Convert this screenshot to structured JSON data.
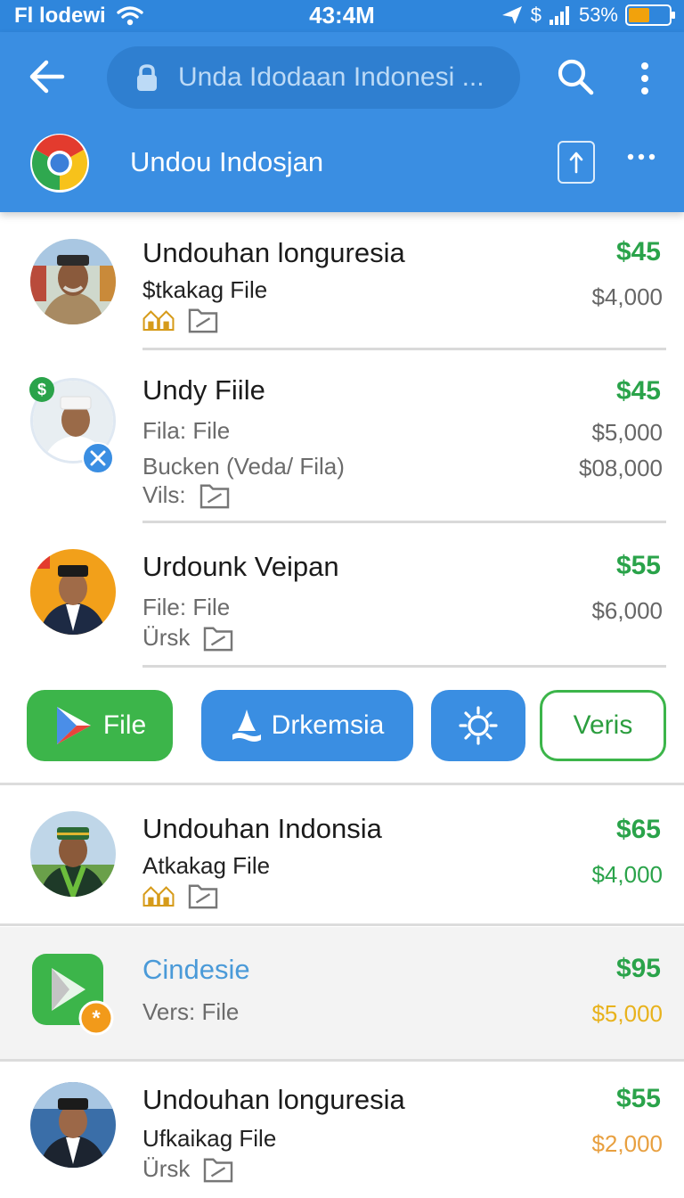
{
  "status_bar": {
    "carrier": "Fl lodewi",
    "time": "43:4M",
    "dollar": "$",
    "battery": "53%",
    "battery_level": 0.53
  },
  "app_bar": {
    "url_text": "Unda Idodaan Indonesi ...",
    "site_title": "Undou Indosjan"
  },
  "items": [
    {
      "title": "Undouhan longuresia",
      "line1": "$tkakag File",
      "price": "$45",
      "price_sub": "$4,000",
      "price_sub_color": "#666666"
    },
    {
      "title": "Undy Fiile",
      "line1": "Fila: File",
      "line2": "Bucken (Veda/ Fila)",
      "line3": "Vils:",
      "price": "$45",
      "price_sub": "$5,000",
      "price_sub2": "$08,000"
    },
    {
      "title": "Urdounk Veipan",
      "line1": "File: File",
      "line2": "Ürsk",
      "price": "$55",
      "price_sub": "$6,000"
    },
    {
      "title": "Undouhan Indonsia",
      "line1": "Atkakag File",
      "price": "$65",
      "price_sub": "$4,000",
      "price_sub_color": "#2aa34a"
    },
    {
      "title": "Cindesie",
      "line1": "Vers: File",
      "price": "$95",
      "price_sub": "$5,000",
      "price_sub_color": "#e8b21c"
    },
    {
      "title": "Undouhan longuresia",
      "line1": "Ufkaikag File",
      "line2": "Ürsk",
      "price": "$55",
      "price_sub": "$2,000",
      "price_sub_color": "#e8a040"
    }
  ],
  "actions": {
    "file_label": "File",
    "drk_label": "Drkemsia",
    "veris_label": "Veris"
  },
  "colors": {
    "app_bar": "#3a8ee2",
    "status_bar": "#2f86dc",
    "price_green": "#2aa34a",
    "button_green": "#3cb54a",
    "button_blue": "#3a8ee2"
  },
  "icons": {
    "back": "arrow-left-icon",
    "lock": "lock-icon",
    "search": "search-icon",
    "kebab": "more-vertical-icon",
    "share": "share-icon",
    "more": "more-horizontal-icon",
    "house": "house-icon",
    "folder": "folder-icon",
    "play": "play-icon",
    "sun": "sun-icon",
    "boat": "boat-icon"
  }
}
